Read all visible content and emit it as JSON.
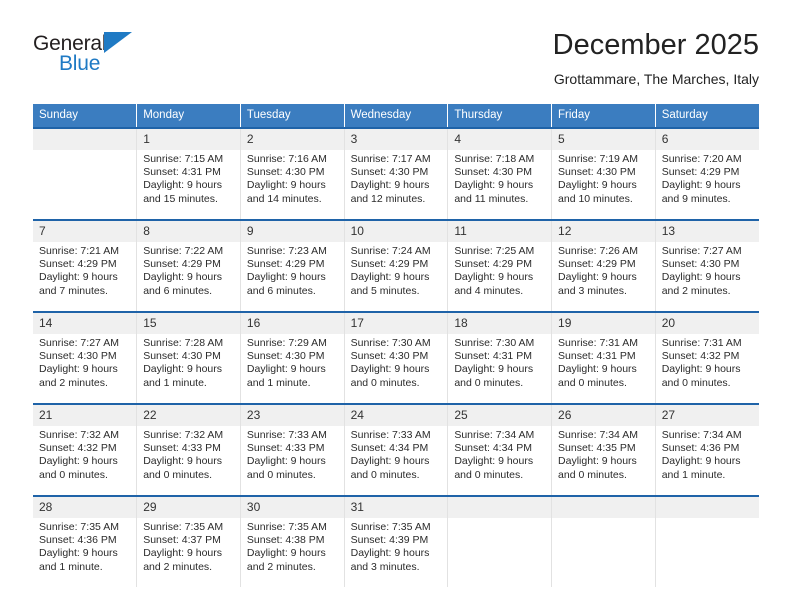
{
  "brand": {
    "name_part1": "General",
    "name_part2": "Blue",
    "triangle_color": "#1f7ac4"
  },
  "header": {
    "title": "December 2025",
    "subtitle": "Grottammare, The Marches, Italy"
  },
  "colors": {
    "header_band": "#3b7dc0",
    "row_divider": "#1f63a8",
    "daynum_band": "#f0f0f0",
    "text": "#222222"
  },
  "weekday_headers": [
    "Sunday",
    "Monday",
    "Tuesday",
    "Wednesday",
    "Thursday",
    "Friday",
    "Saturday"
  ],
  "weeks": [
    [
      {
        "day": "",
        "sunrise": "",
        "sunset": "",
        "daylight_line1": "",
        "daylight_line2": ""
      },
      {
        "day": "1",
        "sunrise": "Sunrise: 7:15 AM",
        "sunset": "Sunset: 4:31 PM",
        "daylight_line1": "Daylight: 9 hours",
        "daylight_line2": "and 15 minutes."
      },
      {
        "day": "2",
        "sunrise": "Sunrise: 7:16 AM",
        "sunset": "Sunset: 4:30 PM",
        "daylight_line1": "Daylight: 9 hours",
        "daylight_line2": "and 14 minutes."
      },
      {
        "day": "3",
        "sunrise": "Sunrise: 7:17 AM",
        "sunset": "Sunset: 4:30 PM",
        "daylight_line1": "Daylight: 9 hours",
        "daylight_line2": "and 12 minutes."
      },
      {
        "day": "4",
        "sunrise": "Sunrise: 7:18 AM",
        "sunset": "Sunset: 4:30 PM",
        "daylight_line1": "Daylight: 9 hours",
        "daylight_line2": "and 11 minutes."
      },
      {
        "day": "5",
        "sunrise": "Sunrise: 7:19 AM",
        "sunset": "Sunset: 4:30 PM",
        "daylight_line1": "Daylight: 9 hours",
        "daylight_line2": "and 10 minutes."
      },
      {
        "day": "6",
        "sunrise": "Sunrise: 7:20 AM",
        "sunset": "Sunset: 4:29 PM",
        "daylight_line1": "Daylight: 9 hours",
        "daylight_line2": "and 9 minutes."
      }
    ],
    [
      {
        "day": "7",
        "sunrise": "Sunrise: 7:21 AM",
        "sunset": "Sunset: 4:29 PM",
        "daylight_line1": "Daylight: 9 hours",
        "daylight_line2": "and 7 minutes."
      },
      {
        "day": "8",
        "sunrise": "Sunrise: 7:22 AM",
        "sunset": "Sunset: 4:29 PM",
        "daylight_line1": "Daylight: 9 hours",
        "daylight_line2": "and 6 minutes."
      },
      {
        "day": "9",
        "sunrise": "Sunrise: 7:23 AM",
        "sunset": "Sunset: 4:29 PM",
        "daylight_line1": "Daylight: 9 hours",
        "daylight_line2": "and 6 minutes."
      },
      {
        "day": "10",
        "sunrise": "Sunrise: 7:24 AM",
        "sunset": "Sunset: 4:29 PM",
        "daylight_line1": "Daylight: 9 hours",
        "daylight_line2": "and 5 minutes."
      },
      {
        "day": "11",
        "sunrise": "Sunrise: 7:25 AM",
        "sunset": "Sunset: 4:29 PM",
        "daylight_line1": "Daylight: 9 hours",
        "daylight_line2": "and 4 minutes."
      },
      {
        "day": "12",
        "sunrise": "Sunrise: 7:26 AM",
        "sunset": "Sunset: 4:29 PM",
        "daylight_line1": "Daylight: 9 hours",
        "daylight_line2": "and 3 minutes."
      },
      {
        "day": "13",
        "sunrise": "Sunrise: 7:27 AM",
        "sunset": "Sunset: 4:30 PM",
        "daylight_line1": "Daylight: 9 hours",
        "daylight_line2": "and 2 minutes."
      }
    ],
    [
      {
        "day": "14",
        "sunrise": "Sunrise: 7:27 AM",
        "sunset": "Sunset: 4:30 PM",
        "daylight_line1": "Daylight: 9 hours",
        "daylight_line2": "and 2 minutes."
      },
      {
        "day": "15",
        "sunrise": "Sunrise: 7:28 AM",
        "sunset": "Sunset: 4:30 PM",
        "daylight_line1": "Daylight: 9 hours",
        "daylight_line2": "and 1 minute."
      },
      {
        "day": "16",
        "sunrise": "Sunrise: 7:29 AM",
        "sunset": "Sunset: 4:30 PM",
        "daylight_line1": "Daylight: 9 hours",
        "daylight_line2": "and 1 minute."
      },
      {
        "day": "17",
        "sunrise": "Sunrise: 7:30 AM",
        "sunset": "Sunset: 4:30 PM",
        "daylight_line1": "Daylight: 9 hours",
        "daylight_line2": "and 0 minutes."
      },
      {
        "day": "18",
        "sunrise": "Sunrise: 7:30 AM",
        "sunset": "Sunset: 4:31 PM",
        "daylight_line1": "Daylight: 9 hours",
        "daylight_line2": "and 0 minutes."
      },
      {
        "day": "19",
        "sunrise": "Sunrise: 7:31 AM",
        "sunset": "Sunset: 4:31 PM",
        "daylight_line1": "Daylight: 9 hours",
        "daylight_line2": "and 0 minutes."
      },
      {
        "day": "20",
        "sunrise": "Sunrise: 7:31 AM",
        "sunset": "Sunset: 4:32 PM",
        "daylight_line1": "Daylight: 9 hours",
        "daylight_line2": "and 0 minutes."
      }
    ],
    [
      {
        "day": "21",
        "sunrise": "Sunrise: 7:32 AM",
        "sunset": "Sunset: 4:32 PM",
        "daylight_line1": "Daylight: 9 hours",
        "daylight_line2": "and 0 minutes."
      },
      {
        "day": "22",
        "sunrise": "Sunrise: 7:32 AM",
        "sunset": "Sunset: 4:33 PM",
        "daylight_line1": "Daylight: 9 hours",
        "daylight_line2": "and 0 minutes."
      },
      {
        "day": "23",
        "sunrise": "Sunrise: 7:33 AM",
        "sunset": "Sunset: 4:33 PM",
        "daylight_line1": "Daylight: 9 hours",
        "daylight_line2": "and 0 minutes."
      },
      {
        "day": "24",
        "sunrise": "Sunrise: 7:33 AM",
        "sunset": "Sunset: 4:34 PM",
        "daylight_line1": "Daylight: 9 hours",
        "daylight_line2": "and 0 minutes."
      },
      {
        "day": "25",
        "sunrise": "Sunrise: 7:34 AM",
        "sunset": "Sunset: 4:34 PM",
        "daylight_line1": "Daylight: 9 hours",
        "daylight_line2": "and 0 minutes."
      },
      {
        "day": "26",
        "sunrise": "Sunrise: 7:34 AM",
        "sunset": "Sunset: 4:35 PM",
        "daylight_line1": "Daylight: 9 hours",
        "daylight_line2": "and 0 minutes."
      },
      {
        "day": "27",
        "sunrise": "Sunrise: 7:34 AM",
        "sunset": "Sunset: 4:36 PM",
        "daylight_line1": "Daylight: 9 hours",
        "daylight_line2": "and 1 minute."
      }
    ],
    [
      {
        "day": "28",
        "sunrise": "Sunrise: 7:35 AM",
        "sunset": "Sunset: 4:36 PM",
        "daylight_line1": "Daylight: 9 hours",
        "daylight_line2": "and 1 minute."
      },
      {
        "day": "29",
        "sunrise": "Sunrise: 7:35 AM",
        "sunset": "Sunset: 4:37 PM",
        "daylight_line1": "Daylight: 9 hours",
        "daylight_line2": "and 2 minutes."
      },
      {
        "day": "30",
        "sunrise": "Sunrise: 7:35 AM",
        "sunset": "Sunset: 4:38 PM",
        "daylight_line1": "Daylight: 9 hours",
        "daylight_line2": "and 2 minutes."
      },
      {
        "day": "31",
        "sunrise": "Sunrise: 7:35 AM",
        "sunset": "Sunset: 4:39 PM",
        "daylight_line1": "Daylight: 9 hours",
        "daylight_line2": "and 3 minutes."
      },
      {
        "day": "",
        "sunrise": "",
        "sunset": "",
        "daylight_line1": "",
        "daylight_line2": ""
      },
      {
        "day": "",
        "sunrise": "",
        "sunset": "",
        "daylight_line1": "",
        "daylight_line2": ""
      },
      {
        "day": "",
        "sunrise": "",
        "sunset": "",
        "daylight_line1": "",
        "daylight_line2": ""
      }
    ]
  ]
}
